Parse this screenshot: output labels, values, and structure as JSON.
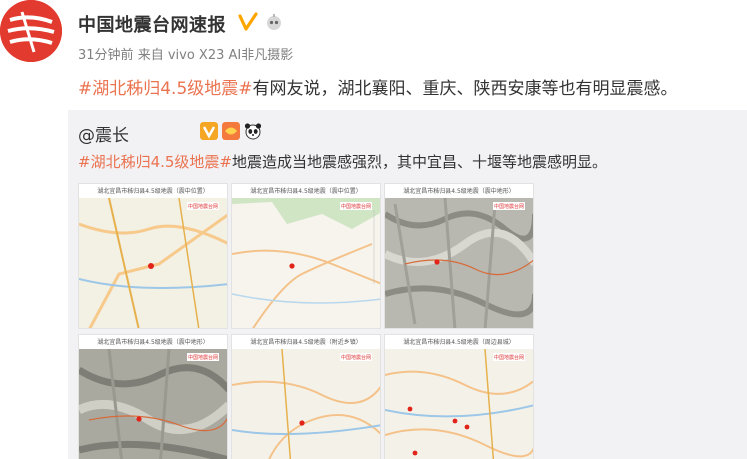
{
  "post": {
    "author": "中国地震台网速报",
    "time": "31分钟前",
    "source_prefix": "来自",
    "source": "vivo X23 AI非凡摄影",
    "hashtag": "#湖北秭归4.5级地震#",
    "text": "有网友说，湖北襄阳、重庆、陕西安康等也有明显震感。"
  },
  "repost": {
    "user": "@震长",
    "hashtag": "#湖北秭归4.5级地震#",
    "text": "地震造成当地震感强烈，其中宜昌、十堰等地震感明显。",
    "images": [
      {
        "caption": "湖北宜昌市秭归县4.5级地震（震中位置）",
        "style": "road"
      },
      {
        "caption": "湖北宜昌市秭归县4.5级地震（震中位置）",
        "style": "plain"
      },
      {
        "caption": "湖北宜昌市秭归县4.5级地震（震中地形）",
        "style": "terrain"
      },
      {
        "caption": "湖北宜昌市秭归县4.5级地震（震中地形）",
        "style": "terrain"
      },
      {
        "caption": "湖北宜昌市秭归县4.5级地震（附近乡镇）",
        "style": "road"
      },
      {
        "caption": "湖北宜昌市秭归县4.5级地震（周边县城）",
        "style": "road"
      }
    ]
  },
  "colors": {
    "tag": "#eb7350",
    "avatar_red": "#e23a2e",
    "verified": "#ffa500"
  }
}
